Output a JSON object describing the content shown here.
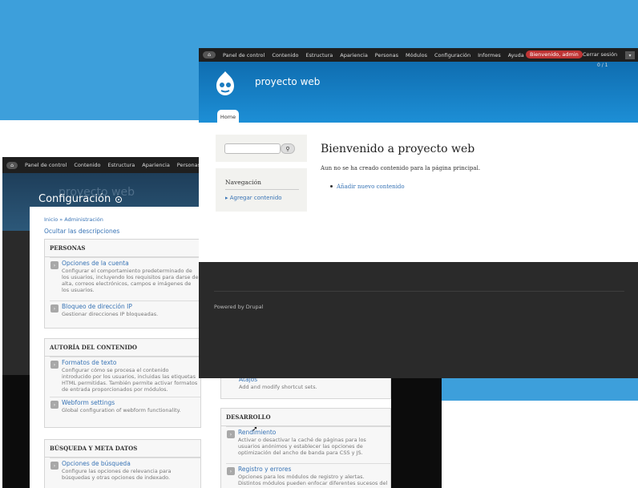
{
  "back": {
    "toolbar": [
      "Panel de control",
      "Contenido",
      "Estructura",
      "Apariencia",
      "Personas"
    ],
    "ghost_site": "proyecto web",
    "title": "Configuración",
    "breadcrumb": "Inicio » Administración",
    "hide_desc": "Ocultar las descripciones",
    "boxes": {
      "personas": {
        "header": "PERSONAS",
        "items": [
          {
            "title": "Opciones de la cuenta",
            "desc": "Configurar el comportamiento predeterminado de los usuarios, incluyendo los requisitos para darse de alta, correos electrónicos, campos e imágenes de los usuarios."
          },
          {
            "title": "Bloqueo de dirección IP",
            "desc": "Gestionar direcciones IP bloqueadas."
          }
        ]
      },
      "autoria": {
        "header": "AUTORÍA DEL CONTENIDO",
        "items": [
          {
            "title": "Formatos de texto",
            "desc": "Configurar cómo se procesa el contenido introducido por los usuarios, incluidas las etiquetas HTML permitidas. También permite activar formatos de entrada proporcionados por módulos."
          },
          {
            "title": "Webform settings",
            "desc": "Global configuration of webform functionality."
          }
        ]
      },
      "busqueda": {
        "header": "BÚSQUEDA Y META DATOS",
        "items": [
          {
            "title": "Opciones de búsqueda",
            "desc": "Configure las opciones de relevancia para búsquedas y otras opciones de indexado."
          }
        ]
      },
      "atajos": {
        "items": [
          {
            "title": "Atajos",
            "desc": "Add and modify shortcut sets."
          }
        ]
      },
      "desarrollo": {
        "header": "DESARROLLO",
        "items": [
          {
            "title": "Rendimiento",
            "desc": "Activar o desactivar la caché de páginas para los usuarios anónimos y establecer las opciones de optimización del ancho de banda para CSS y JS."
          },
          {
            "title": "Registro y errores",
            "desc": "Opciones para los módulos de registro y alertas. Distintos módulos pueden enfocar diferentes sucesos del"
          }
        ]
      }
    }
  },
  "front": {
    "toolbar": [
      "Panel de control",
      "Contenido",
      "Estructura",
      "Apariencia",
      "Personas",
      "Módulos",
      "Configuración",
      "Informes",
      "Ayuda"
    ],
    "welcome": "Bienvenido, admin",
    "logout": "Cerrar sesión",
    "shortcut_count": "0 / 1",
    "site_name": "proyecto web",
    "tab_home": "Home",
    "nav_title": "Navegación",
    "nav_link": "Agregar contenido",
    "main_title": "Bienvenido a proyecto web",
    "main_text": "Aun no se ha creado contenido para la página principal.",
    "main_link": "Añadir nuevo contenido",
    "powered": "Powered by Drupal"
  },
  "colors": {
    "accent": "#3d9fdb",
    "link": "#3773b5",
    "welcome_badge": "#c03535"
  }
}
